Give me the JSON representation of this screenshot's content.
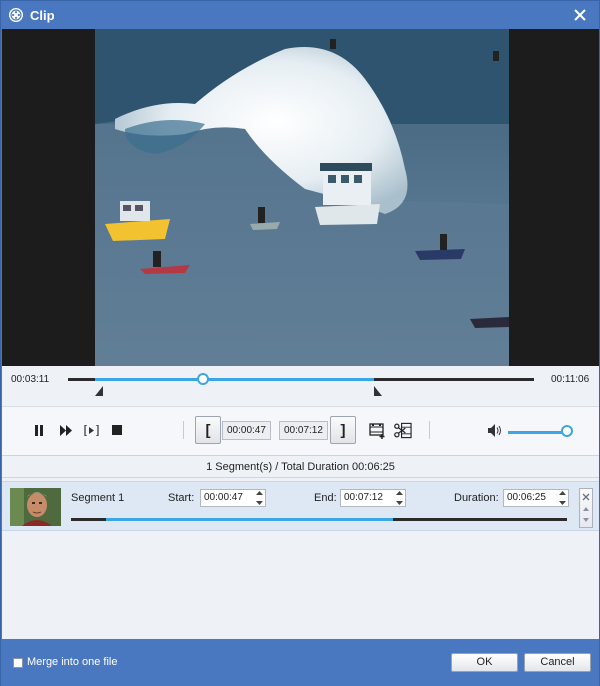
{
  "window": {
    "title": "Clip",
    "icon": "film-reel-icon",
    "close": "close-icon"
  },
  "timeline": {
    "current_time": "00:03:11",
    "total_time": "00:11:06",
    "playhead_fraction": 0.29,
    "selection_start_fraction": 0.057,
    "selection_end_fraction": 0.656
  },
  "controls": {
    "pause_icon": "pause-icon",
    "fast_forward_icon": "fast-forward-icon",
    "play_selection_icon": "play-selection-icon",
    "stop_icon": "stop-icon",
    "set_start_label": "[",
    "start_time": "00:00:47",
    "end_time": "00:07:12",
    "set_end_label": "]",
    "new_clip_icon": "add-clip-icon",
    "split_icon": "scissors-icon",
    "volume_icon": "speaker-icon",
    "volume_fraction": 0.95
  },
  "summary": "1 Segment(s) / Total Duration 00:06:25",
  "segments": [
    {
      "name": "Segment 1",
      "start_label": "Start:",
      "start": "00:00:47",
      "end_label": "End:",
      "end": "00:07:12",
      "duration_label": "Duration:",
      "duration": "00:06:25",
      "range_start_fraction": 0.07,
      "range_end_fraction": 0.65
    }
  ],
  "footer": {
    "merge_label": "Merge into one file",
    "merge_checked": false,
    "ok_label": "OK",
    "cancel_label": "Cancel"
  },
  "colors": {
    "accent": "#3aa6e6",
    "chrome": "#4a78c0",
    "panel": "#eef1f6"
  }
}
